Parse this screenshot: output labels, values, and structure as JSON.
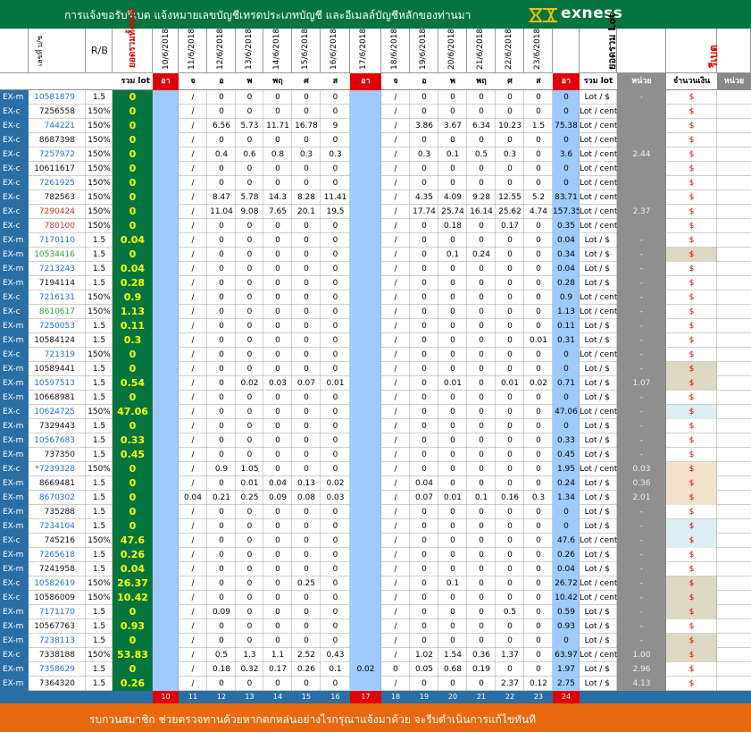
{
  "header": {
    "title": "การแจ้งขอรับรีเบต   แจ้งหมายเลขบัญชีเทรดประเภทบัญชี  และอีเมลล์บัญชีหลักของท่านมา",
    "brand": "exness",
    "logo_icon": "exness-x-logo",
    "bg_color": "#05753f"
  },
  "columns": {
    "code_header": "เลขที่ บ/ช",
    "rb_header": "R/B",
    "total_header": "ยอดรวมทั้งหมด",
    "dates": [
      "10/6/2018",
      "11/6/2018",
      "12/6/2018",
      "13/6/2018",
      "14/6/2018",
      "15/6/2018",
      "16/6/2018",
      "17/6/2018",
      "18/6/2018",
      "19/6/2018",
      "20/6/2018",
      "21/6/2018",
      "22/6/2018",
      "23/6/2018"
    ],
    "lot_total_header": "ยอดรวม Lot",
    "rebate_header": "รีเบต"
  },
  "day_row": {
    "lot_label": "รวม lot",
    "days": [
      "อา",
      "จ",
      "อ",
      "พ",
      "พฤ",
      "ศ",
      "ส",
      "อา",
      "จ",
      "อ",
      "พ",
      "พฤ",
      "ศ",
      "ส",
      "อา"
    ],
    "sum_label": "รวม lot",
    "unit_label": "หน่วย",
    "amount_label": "จำนวนเงิน",
    "unit2_label": "หน่วย"
  },
  "rows": [
    [
      "EX-m",
      "10581879",
      "1.5",
      "0",
      "",
      "/",
      "0",
      "0",
      "0",
      "0",
      "0",
      "",
      "/",
      "0",
      "0",
      "0",
      "0",
      "0",
      "0",
      "Lot / $",
      "-",
      "$"
    ],
    [
      "EX-c",
      "7256558",
      "150%",
      "0",
      "",
      "/",
      "0",
      "0",
      "0",
      "0",
      "0",
      "",
      "/",
      "0",
      "0",
      "0",
      "0",
      "0",
      "0",
      "Lot / cent",
      "",
      "$"
    ],
    [
      "EX-c",
      "744221",
      "150%",
      "0",
      "",
      "/",
      "6.56",
      "5.73",
      "11.71",
      "16.78",
      "9",
      "",
      "/",
      "3.86",
      "3.67",
      "6.34",
      "10.23",
      "1.5",
      "75.38",
      "Lot / cent",
      "",
      "$"
    ],
    [
      "EX-c",
      "8687398",
      "150%",
      "0",
      "",
      "/",
      "0",
      "0",
      "0",
      "0",
      "0",
      "",
      "/",
      "0",
      "0",
      "0",
      "0",
      "0",
      "0",
      "Lot / cent",
      "",
      "$"
    ],
    [
      "EX-c",
      "7257972",
      "150%",
      "0",
      "",
      "/",
      "0.4",
      "0.6",
      "0.8",
      "0.3",
      "0.3",
      "",
      "/",
      "0.3",
      "0.1",
      "0.5",
      "0.3",
      "0",
      "3.6",
      "Lot / cent",
      "2.44",
      "$"
    ],
    [
      "EX-c",
      "10611617",
      "150%",
      "0",
      "",
      "/",
      "0",
      "0",
      "0",
      "0",
      "0",
      "",
      "/",
      "0",
      "0",
      "0",
      "0",
      "0",
      "0",
      "Lot / cent",
      "",
      "$"
    ],
    [
      "EX-c",
      "7261925",
      "150%",
      "0",
      "",
      "/",
      "0",
      "0",
      "0",
      "0",
      "0",
      "",
      "/",
      "0",
      "0",
      "0",
      "0",
      "0",
      "0",
      "Lot / cent",
      "",
      "$"
    ],
    [
      "EX-c",
      "782563",
      "150%",
      "0",
      "",
      "/",
      "8.47",
      "5.78",
      "14.3",
      "8.28",
      "11.41",
      "",
      "/",
      "4.35",
      "4.09",
      "9.28",
      "12.55",
      "5.2",
      "83.71",
      "Lot / cent",
      "",
      "$"
    ],
    [
      "EX-c",
      "7290424",
      "150%",
      "0",
      "",
      "/",
      "11.04",
      "9.08",
      "7.65",
      "20.1",
      "19.5",
      "",
      "/",
      "17.74",
      "25.74",
      "16.14",
      "25.62",
      "4.74",
      "157.35",
      "Lot / cent",
      "2.37",
      "$"
    ],
    [
      "EX-c",
      "780100",
      "150%",
      "0",
      "",
      "/",
      "0",
      "0",
      "0",
      "0",
      "0",
      "",
      "/",
      "0",
      "0.18",
      "0",
      "0.17",
      "0",
      "0.35",
      "Lot / cent",
      "",
      "$"
    ],
    [
      "EX-m",
      "7170110",
      "1.5",
      "0.04",
      "",
      "/",
      "0",
      "0",
      "0",
      "0",
      "0",
      "",
      "/",
      "0",
      "0",
      "0",
      "0",
      "0",
      "0.04",
      "Lot / $",
      "-",
      "$"
    ],
    [
      "EX-m",
      "10534416",
      "1.5",
      "0",
      "",
      "/",
      "0",
      "0",
      "0",
      "0",
      "0",
      "",
      "/",
      "0",
      "0.1",
      "0.24",
      "0",
      "0",
      "0.34",
      "Lot / $",
      "-",
      "$"
    ],
    [
      "EX-m",
      "7213243",
      "1.5",
      "0.04",
      "",
      "/",
      "0",
      "0",
      "0",
      "0",
      "0",
      "",
      "/",
      "0",
      "0",
      "0",
      "0",
      "0",
      "0.04",
      "Lot / $",
      "-",
      "$"
    ],
    [
      "EX-m",
      "7194114",
      "1.5",
      "0.28",
      "",
      "/",
      "0",
      "0",
      "0",
      "0",
      "0",
      "",
      "/",
      "0",
      "0",
      "0",
      "0",
      "0",
      "0.28",
      "Lot / $",
      "-",
      "$"
    ],
    [
      "EX-c",
      "7216131",
      "150%",
      "0.9",
      "",
      "/",
      "0",
      "0",
      "0",
      "0",
      "0",
      "",
      "/",
      "0",
      "0",
      "0",
      "0",
      "0",
      "0.9",
      "Lot / cent",
      "-",
      "$"
    ],
    [
      "EX-c",
      "8610617",
      "150%",
      "1.13",
      "",
      "/",
      "0",
      "0",
      "0",
      "0",
      "0",
      "",
      "/",
      "0",
      "0",
      "0",
      "0",
      "0",
      "1.13",
      "Lot / cent",
      "-",
      "$"
    ],
    [
      "EX-m",
      "7250053",
      "1.5",
      "0.11",
      "",
      "/",
      "0",
      "0",
      "0",
      "0",
      "0",
      "",
      "/",
      "0",
      "0",
      "0",
      "0",
      "0",
      "0.11",
      "Lot / $",
      "-",
      "$"
    ],
    [
      "EX-m",
      "10584124",
      "1.5",
      "0.3",
      "",
      "/",
      "0",
      "0",
      "0",
      "0",
      "0",
      "",
      "/",
      "0",
      "0",
      "0",
      "0",
      "0.01",
      "0.31",
      "Lot / $",
      "-",
      "$"
    ],
    [
      "EX-c",
      "721319",
      "150%",
      "0",
      "",
      "/",
      "0",
      "0",
      "0",
      "0",
      "0",
      "",
      "/",
      "0",
      "0",
      "0",
      "0",
      "0",
      "0",
      "Lot / cent",
      "-",
      "$"
    ],
    [
      "EX-m",
      "10589441",
      "1.5",
      "0",
      "",
      "/",
      "0",
      "0",
      "0",
      "0",
      "0",
      "",
      "/",
      "0",
      "0",
      "0",
      "0",
      "0",
      "0",
      "Lot / $",
      "-",
      "$"
    ],
    [
      "EX-m",
      "10597513",
      "1.5",
      "0.54",
      "",
      "/",
      "0",
      "0.02",
      "0.03",
      "0.07",
      "0.01",
      "",
      "/",
      "0",
      "0.01",
      "0",
      "0.01",
      "0.02",
      "0.71",
      "Lot / $",
      "1.07",
      "$"
    ],
    [
      "EX-m",
      "10668981",
      "1.5",
      "0",
      "",
      "/",
      "0",
      "0",
      "0",
      "0",
      "0",
      "",
      "/",
      "0",
      "0",
      "0",
      "0",
      "0",
      "0",
      "Lot / $",
      "-",
      "$"
    ],
    [
      "EX-c",
      "10624725",
      "150%",
      "47.06",
      "",
      "/",
      "0",
      "0",
      "0",
      "0",
      "0",
      "",
      "/",
      "0",
      "0",
      "0",
      "0",
      "0",
      "47.06",
      "Lot / cent",
      "-",
      "$"
    ],
    [
      "EX-m",
      "7329443",
      "1.5",
      "0",
      "",
      "/",
      "0",
      "0",
      "0",
      "0",
      "0",
      "",
      "/",
      "0",
      "0",
      "0",
      "0",
      "0",
      "0",
      "Lot / $",
      "-",
      "$"
    ],
    [
      "EX-m",
      "10567683",
      "1.5",
      "0.33",
      "",
      "/",
      "0",
      "0",
      "0",
      "0",
      "0",
      "",
      "/",
      "0",
      "0",
      "0",
      "0",
      "0",
      "0.33",
      "Lot / $",
      "-",
      "$"
    ],
    [
      "EX-m",
      "737350",
      "1.5",
      "0.45",
      "",
      "/",
      "0",
      "0",
      "0",
      "0",
      "0",
      "",
      "/",
      "0",
      "0",
      "0",
      "0",
      "0",
      "0.45",
      "Lot / $",
      "-",
      "$"
    ],
    [
      "EX-c",
      "*7239328",
      "150%",
      "0",
      "",
      "/",
      "0.9",
      "1.05",
      "0",
      "0",
      "0",
      "",
      "/",
      "0",
      "0",
      "0",
      "0",
      "0",
      "1.95",
      "Lot / cent",
      "0.03",
      "$"
    ],
    [
      "EX-m",
      "8669481",
      "1.5",
      "0",
      "",
      "/",
      "0",
      "0.01",
      "0.04",
      "0.13",
      "0.02",
      "",
      "/",
      "0.04",
      "0",
      "0",
      "0",
      "0",
      "0.24",
      "Lot / $",
      "0.36",
      "$"
    ],
    [
      "EX-m",
      "8670302",
      "1.5",
      "0",
      "",
      "0.04",
      "0.21",
      "0.25",
      "0.09",
      "0.08",
      "0.03",
      "",
      "/",
      "0.07",
      "0.01",
      "0.1",
      "0.16",
      "0.3",
      "1.34",
      "Lot / $",
      "2.01",
      "$"
    ],
    [
      "EX-m",
      "735288",
      "1.5",
      "0",
      "",
      "/",
      "0",
      "0",
      "0",
      "0",
      "0",
      "",
      "/",
      "0",
      "0",
      "0",
      "0",
      "0",
      "0",
      "Lot / $",
      "-",
      "$"
    ],
    [
      "EX-m",
      "7234104",
      "1.5",
      "0",
      "",
      "/",
      "0",
      "0",
      "0",
      "0",
      "0",
      "",
      "/",
      "0",
      "0",
      "0",
      "0",
      "0",
      "0",
      "Lot / $",
      "-",
      "$"
    ],
    [
      "EX-c",
      "745216",
      "150%",
      "47.6",
      "",
      "/",
      "0",
      "0",
      "0",
      "0",
      "0",
      "",
      "/",
      "0",
      "0",
      "0",
      "0",
      "0",
      "47.6",
      "Lot / cent",
      "-",
      "$"
    ],
    [
      "EX-m",
      "7265618",
      "1.5",
      "0.26",
      "",
      "/",
      "0",
      "0",
      "0",
      "0",
      "0",
      "",
      "/",
      "0",
      "0",
      "0",
      "0",
      "0",
      "0.26",
      "Lot / $",
      "-",
      "$"
    ],
    [
      "EX-m",
      "7241958",
      "1.5",
      "0.04",
      "",
      "/",
      "0",
      "0",
      "0",
      "0",
      "0",
      "",
      "/",
      "0",
      "0",
      "0",
      "0",
      "0",
      "0.04",
      "Lot / $",
      "-",
      "$"
    ],
    [
      "EX-c",
      "10582619",
      "150%",
      "26.37",
      "",
      "/",
      "0",
      "0",
      "0",
      "0.25",
      "0",
      "",
      "/",
      "0",
      "0.1",
      "0",
      "0",
      "0",
      "26.72",
      "Lot / cent",
      "-",
      "$"
    ],
    [
      "EX-c",
      "10586009",
      "150%",
      "10.42",
      "",
      "/",
      "0",
      "0",
      "0",
      "0",
      "0",
      "",
      "/",
      "0",
      "0",
      "0",
      "0",
      "0",
      "10.42",
      "Lot / cent",
      "-",
      "$"
    ],
    [
      "EX-m",
      "7171170",
      "1.5",
      "0",
      "",
      "/",
      "0.09",
      "0",
      "0",
      "0",
      "0",
      "",
      "/",
      "0",
      "0",
      "0",
      "0.5",
      "0",
      "0.59",
      "Lot / $",
      "-",
      "$"
    ],
    [
      "EX-m",
      "10567763",
      "1.5",
      "0.93",
      "",
      "/",
      "0",
      "0",
      "0",
      "0",
      "0",
      "",
      "/",
      "0",
      "0",
      "0",
      "0",
      "0",
      "0.93",
      "Lot / $",
      "-",
      "$"
    ],
    [
      "EX-m",
      "7238113",
      "1.5",
      "0",
      "",
      "/",
      "0",
      "0",
      "0",
      "0",
      "0",
      "",
      "/",
      "0",
      "0",
      "0",
      "0",
      "0",
      "0",
      "Lot / $",
      "-",
      "$"
    ],
    [
      "EX-c",
      "7338188",
      "150%",
      "53.83",
      "",
      "/",
      "0.5",
      "1.3",
      "1.1",
      "2.52",
      "0.43",
      "",
      "/",
      "1.02",
      "1.54",
      "0.36",
      "1.37",
      "0",
      "63.97",
      "Lot / cent",
      "1.00",
      "$"
    ],
    [
      "EX-m",
      "7358629",
      "1.5",
      "0",
      "",
      "/",
      "0.18",
      "0.32",
      "0.17",
      "0.26",
      "0.1",
      "0.02",
      "0",
      "0.05",
      "0.68",
      "0.19",
      "0",
      "0",
      "1.97",
      "Lot / $",
      "2.96",
      "$"
    ],
    [
      "EX-m",
      "7364320",
      "1.5",
      "0.26",
      "",
      "/",
      "0",
      "0",
      "0",
      "0",
      "0",
      "",
      "/",
      "0",
      "0",
      "0",
      "2.37",
      "0.12",
      "2.75",
      "Lot / $",
      "4.13",
      "$"
    ]
  ],
  "footer_numbers": [
    "10",
    "11",
    "12",
    "13",
    "14",
    "15",
    "16",
    "17",
    "18",
    "19",
    "20",
    "21",
    "22",
    "23",
    "24"
  ],
  "footer": {
    "message": "รบกวนสมาชิก ช่วยตรวจทานด้วยหากตกหล่นอย่างไรกรุณาแจ้งมาด้วย  จะรีบดำเนินการแก้ไขทันที",
    "bg_color": "#e8690f"
  },
  "colors": {
    "type_col_bg": "#2a6ea6",
    "total_col_bg": "#05753f",
    "total_col_text": "#ffff00",
    "weekend_bg": "#9fcaff",
    "sunday_marker": "#e10000",
    "unit_col_bg": "#8f8f8f",
    "dollar_col_bg": "#888888",
    "amount_red": "#e10000"
  }
}
